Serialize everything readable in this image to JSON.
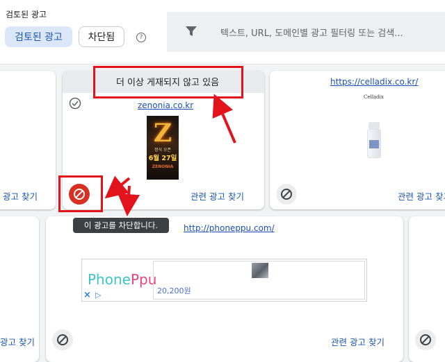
{
  "header": {
    "title": "검토된 광고",
    "chips": {
      "reviewed": "검토된 광고",
      "blocked": "차단됨"
    },
    "help_glyph": "?"
  },
  "search": {
    "placeholder": "텍스트, URL, 도메인별 광고 필터링 또는 검색..."
  },
  "cards": {
    "left_top": {
      "related_label": "광고 찾기"
    },
    "middle_top": {
      "status_banner": "더 이상 게재되지 않고 있음",
      "domain": "zenonia.co.kr",
      "ad_image": {
        "big_letter": "Z",
        "date_text": "6월 27일",
        "tagline": "정식 오픈",
        "brand": "ZENONIA"
      },
      "related_label": "관련 광고 찾기"
    },
    "right_top": {
      "url": "https://celladix.co.kr/",
      "brand": "Celladix",
      "related_label": "관련 광고 찾기"
    },
    "left_bottom": {
      "related_label": "광고 찾기"
    },
    "middle_bottom": {
      "url": "http://phoneppu.com/",
      "ad": {
        "brand_part1": "Phone",
        "brand_part2": "Ppu",
        "price": "20,200원",
        "close_glyph": "×",
        "adchoices_glyph": "▷"
      },
      "related_label": "관련 광고 찾기"
    }
  },
  "tooltip": "이 광고를 차단합니다.",
  "colors": {
    "accent_blue": "#1a56b0",
    "chip_selected_bg": "#dbe7f8",
    "annotation_red": "#e3131b",
    "block_active_red": "#d93025",
    "tooltip_bg": "#3c4043"
  },
  "icons": [
    "filter-icon",
    "help-icon",
    "check-circle-icon",
    "block-icon",
    "arrow-icon"
  ]
}
